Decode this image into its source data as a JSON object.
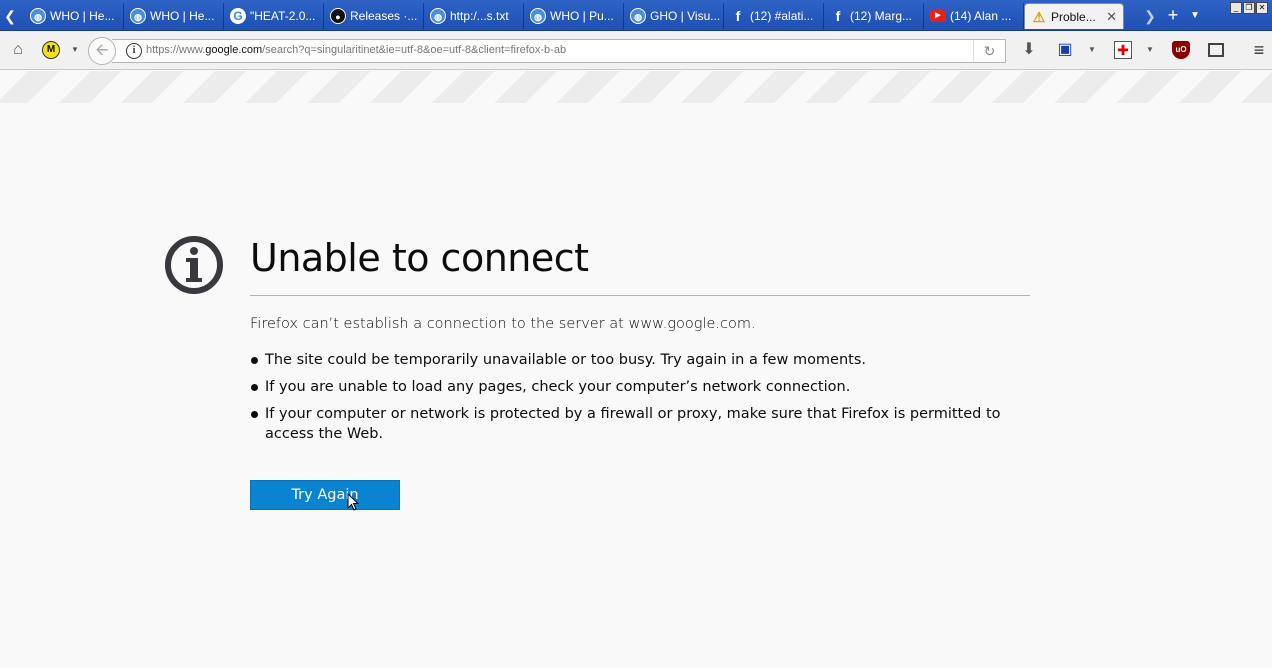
{
  "browser": {
    "tabs": [
      {
        "title": "WHO | He...",
        "icon": "who-globe-icon"
      },
      {
        "title": "WHO | He...",
        "icon": "who-globe-icon"
      },
      {
        "title": "\"HEAT-2.0...",
        "icon": "google-icon"
      },
      {
        "title": "Releases ·...",
        "icon": "github-icon"
      },
      {
        "title": "http:/...s.txt",
        "icon": "who-globe-icon"
      },
      {
        "title": "WHO | Pu...",
        "icon": "who-globe-icon"
      },
      {
        "title": "GHO | Visu...",
        "icon": "who-globe-icon"
      },
      {
        "title": "(12) #alati...",
        "icon": "facebook-icon"
      },
      {
        "title": "(12) Marg...",
        "icon": "facebook-icon"
      },
      {
        "title": "(14) Alan ...",
        "icon": "youtube-icon"
      }
    ],
    "active_tab": {
      "title": "Proble...",
      "icon": "warning-icon"
    },
    "url": {
      "prefix": "https://www.",
      "domain": "google.com",
      "rest": "/search?q=singularitinet&ie=utf-8&oe=utf-8&client=firefox-b-ab"
    }
  },
  "error": {
    "title": "Unable to connect",
    "description": "Firefox can’t establish a connection to the server at www.google.com.",
    "bullets": [
      "The site could be temporarily unavailable or too busy. Try again in a few moments.",
      "If you are unable to load any pages, check your computer’s network connection.",
      "If your computer or network is protected by a firewall or proxy, make sure that Firefox is permitted to access the Web."
    ],
    "button_label": "Try Again"
  },
  "colors": {
    "tabstrip": "#2f63c5",
    "button": "#0a84d0",
    "page_bg": "#f9f9fa"
  }
}
